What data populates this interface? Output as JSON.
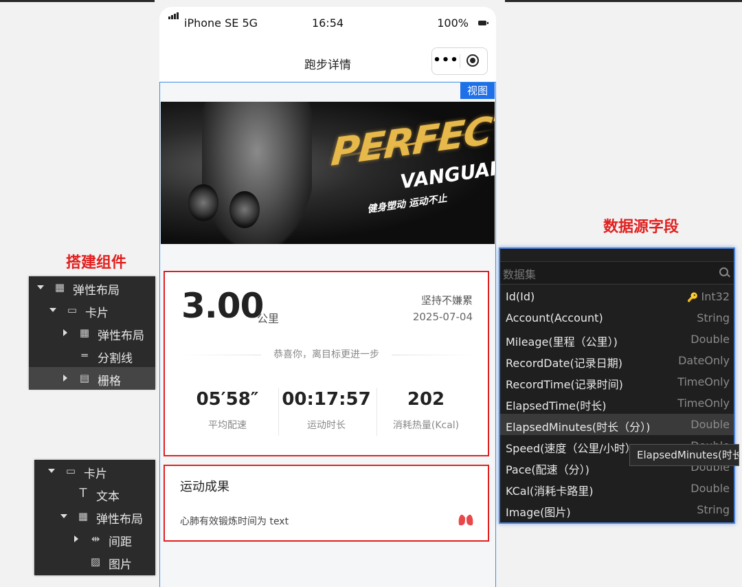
{
  "phone": {
    "status": {
      "carrier": "iPhone SE 5G",
      "time": "16:54",
      "battery": "100%"
    },
    "nav": {
      "title": "跑步详情",
      "more_icon": "more-dots-icon",
      "close_icon": "target-circle-icon"
    },
    "view_tag": "视图",
    "banner": {
      "line1": "PERFECT",
      "line2": "VANGUARD",
      "slogan": "健身塑动 运动不止"
    },
    "summary": {
      "distance": "3.00",
      "unit": "公里",
      "motto": "坚持不嫌累",
      "date": "2025-07-04",
      "congrats": "恭喜你，离目标更进一步",
      "stats": [
        {
          "value": "05′58″",
          "label": "平均配速"
        },
        {
          "value": "00:17:57",
          "label": "运动时长"
        },
        {
          "value": "202",
          "label": "消耗热量(Kcal)"
        }
      ]
    },
    "result": {
      "title": "运动成果",
      "text": "心肺有效锻炼时间为 text",
      "icon": "lungs-icon"
    }
  },
  "labels": {
    "components": "搭建组件",
    "fields": "数据源字段"
  },
  "tree1": {
    "items": [
      {
        "label": "弹性布局",
        "icon": "grid-icon",
        "expand": "down"
      },
      {
        "label": "卡片",
        "icon": "card-icon",
        "expand": "down"
      },
      {
        "label": "弹性布局",
        "icon": "grid-icon",
        "expand": "right"
      },
      {
        "label": "分割线",
        "icon": "divider-icon",
        "expand": ""
      },
      {
        "label": "栅格",
        "icon": "table-icon",
        "expand": "right"
      }
    ]
  },
  "tree2": {
    "items": [
      {
        "label": "卡片",
        "icon": "card-icon",
        "expand": "down"
      },
      {
        "label": "文本",
        "icon": "text-icon",
        "expand": ""
      },
      {
        "label": "弹性布局",
        "icon": "grid-icon",
        "expand": "down"
      },
      {
        "label": "间距",
        "icon": "spacing-icon",
        "expand": "right"
      },
      {
        "label": "图片",
        "icon": "image-icon",
        "expand": ""
      }
    ]
  },
  "datasource": {
    "search_placeholder": "数据集",
    "fields": [
      {
        "name": "Id(Id)",
        "type": "Int32",
        "key": true
      },
      {
        "name": "Account(Account)",
        "type": "String"
      },
      {
        "name": "Mileage(里程（公里）)",
        "type": "Double"
      },
      {
        "name": "RecordDate(记录日期)",
        "type": "DateOnly"
      },
      {
        "name": "RecordTime(记录时间)",
        "type": "TimeOnly"
      },
      {
        "name": "ElapsedTime(时长)",
        "type": "TimeOnly"
      },
      {
        "name": "ElapsedMinutes(时长（分）)",
        "type": "Double",
        "hover": true
      },
      {
        "name": "Speed(速度（公里/小时）)",
        "type": "Double"
      },
      {
        "name": "Pace(配速（分）)",
        "type": "Double"
      },
      {
        "name": "KCal(消耗卡路里)",
        "type": "Double"
      },
      {
        "name": "Image(图片)",
        "type": "String"
      }
    ],
    "tooltip": "ElapsedMinutes(时长（分）)"
  },
  "colors": {
    "accent_red": "#e0201f",
    "accent_blue": "#1e6fe8",
    "panel_bg": "#2b2b2b"
  }
}
